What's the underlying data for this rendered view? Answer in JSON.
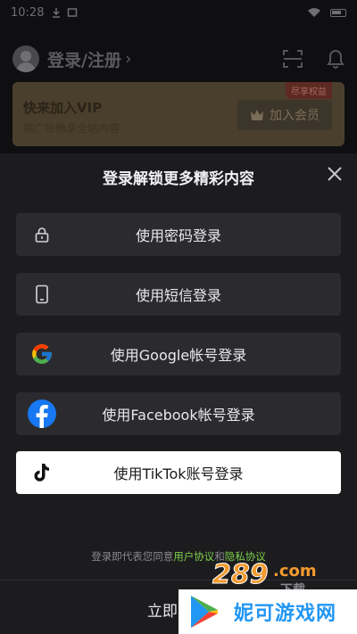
{
  "status_bar": {
    "time": "10:28",
    "battery_icon": "battery-icon",
    "wifi_icon": "wifi-icon"
  },
  "header": {
    "login_label": "登录/注册",
    "chevron": "›",
    "scan_icon": "scan-icon",
    "bell_icon": "bell-icon"
  },
  "vip": {
    "title": "快来加入VIP",
    "subtitle": "跳广告畅享全站内容",
    "badge": "尽享权益",
    "join_label": "加入会员",
    "crown_icon": "crown-icon"
  },
  "sheet": {
    "title": "登录解锁更多精彩内容",
    "options": [
      {
        "label": "使用密码登录",
        "icon": "lock-icon"
      },
      {
        "label": "使用短信登录",
        "icon": "phone-icon"
      },
      {
        "label": "使用Google帐号登录",
        "icon": "google-icon"
      },
      {
        "label": "使用Facebook帐号登录",
        "icon": "facebook-icon"
      },
      {
        "label": "使用TikTok账号登录",
        "icon": "tiktok-icon"
      }
    ],
    "terms_prefix": "登录即代表您同意",
    "terms_link1": "用户协议",
    "terms_and": "和",
    "terms_link2": "隐私协议",
    "footer_label": "立即"
  },
  "watermarks": {
    "site_289": "289.com",
    "site_289_sub": "下载",
    "nigu_text": "妮可游戏网"
  },
  "colors": {
    "link_green": "#7fd14a",
    "sheet_bg": "#1c1c1f",
    "option_bg": "#2b2b2f",
    "facebook_blue": "#1877f2"
  }
}
